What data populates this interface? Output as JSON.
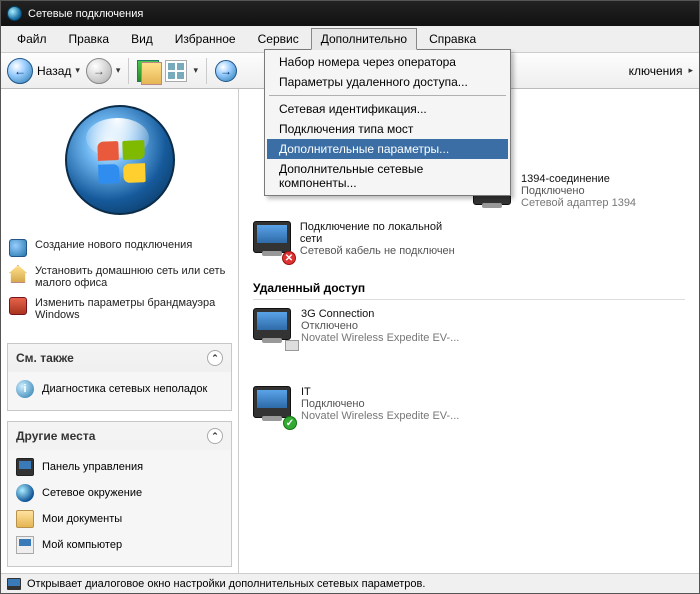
{
  "title": "Сетевые подключения",
  "menu": {
    "file": "Файл",
    "edit": "Правка",
    "view": "Вид",
    "favorites": "Избранное",
    "service": "Сервис",
    "extra": "Дополнительно",
    "help": "Справка"
  },
  "dropdown": {
    "operator_dial": "Набор номера через оператора",
    "remote_access_params": "Параметры удаленного доступа...",
    "network_id": "Сетевая идентификация...",
    "bridge_conns": "Подключения типа мост",
    "advanced_params": "Дополнительные параметры...",
    "extra_net_components": "Дополнительные сетевые компоненты..."
  },
  "toolbar": {
    "back": "Назад"
  },
  "address_tail": "ключения",
  "tasks": {
    "new_conn": "Создание нового подключения",
    "home_net": "Установить домашнюю сеть или сеть малого офиса",
    "firewall": "Изменить параметры брандмауэра Windows"
  },
  "see_also": {
    "title": "См. также",
    "diag": "Диагностика сетевых неполадок"
  },
  "other_places": {
    "title": "Другие места",
    "cp": "Панель управления",
    "net_env": "Сетевое окружение",
    "docs": "Мои документы",
    "pc": "Мой компьютер"
  },
  "sections": {
    "remote": "Удаленный доступ"
  },
  "connections": {
    "c1394": {
      "name": "1394-соединение",
      "status": "Подключено",
      "device": "Сетевой адаптер 1394"
    },
    "lan": {
      "name": "Подключение по локальной сети",
      "status": "Сетевой кабель не подключен"
    },
    "g3": {
      "name": "3G Connection",
      "status": "Отключено",
      "device": "Novatel Wireless Expedite EV-..."
    },
    "it": {
      "name": "IT",
      "status": "Подключено",
      "device": "Novatel Wireless Expedite EV-..."
    }
  },
  "statusbar": "Открывает диалоговое окно настройки дополнительных сетевых параметров."
}
